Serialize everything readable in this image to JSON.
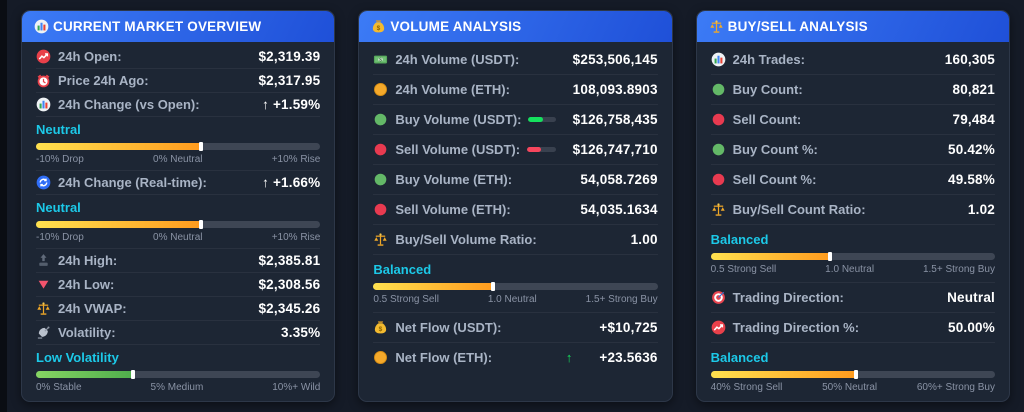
{
  "colors": {
    "green": "#15e15e",
    "red": "#f6465d",
    "cyan": "#1cc9e8",
    "amber_from": "#ffe14f",
    "amber_to": "#ff9b1e",
    "gauge_green_from": "#86d563",
    "gauge_green_to": "#4fae4c",
    "header_blue_from": "#3c7bf6",
    "header_blue_to": "#1f50d8"
  },
  "panels": [
    {
      "id": "current-market-overview",
      "title": "CURRENT MARKET OVERVIEW",
      "header_icon": "bar-chart",
      "items": [
        {
          "type": "row",
          "icon": "chart-up-red",
          "label": "24h Open:",
          "value": "$2,319.39",
          "tone": "white"
        },
        {
          "type": "row",
          "icon": "alarm-clock",
          "label": "Price 24h Ago:",
          "value": "$2,317.95",
          "tone": "white"
        },
        {
          "type": "row",
          "icon": "bar-chart",
          "label": "24h Change (vs Open):",
          "value": "↑ +1.59%",
          "tone": "green"
        },
        {
          "type": "gauge",
          "id": "change-vs-open",
          "status": "Neutral",
          "fill": "amber",
          "fill_pct": 58,
          "ticks": [
            "-10% Drop",
            "0% Neutral",
            "+10% Rise"
          ]
        },
        {
          "type": "row",
          "icon": "refresh-blue",
          "label": "24h Change (Real-time):",
          "value": "↑ +1.66%",
          "tone": "green"
        },
        {
          "type": "gauge",
          "id": "change-realtime",
          "status": "Neutral",
          "fill": "amber",
          "fill_pct": 58,
          "ticks": [
            "-10% Drop",
            "0% Neutral",
            "+10% Rise"
          ]
        },
        {
          "type": "row",
          "icon": "top",
          "label": "24h High:",
          "value": "$2,385.81",
          "tone": "green"
        },
        {
          "type": "row",
          "icon": "triangle-down",
          "label": "24h Low:",
          "value": "$2,308.56",
          "tone": "red"
        },
        {
          "type": "row",
          "icon": "scale-gold",
          "label": "24h VWAP:",
          "value": "$2,345.26",
          "tone": "cyan"
        },
        {
          "type": "row",
          "icon": "satellite",
          "label": "Volatility:",
          "value": "3.35%",
          "tone": "cyan"
        },
        {
          "type": "gauge",
          "id": "volatility",
          "status": "Low Volatility",
          "fill": "green",
          "fill_pct": 34,
          "ticks": [
            "0% Stable",
            "5% Medium",
            "10%+ Wild"
          ]
        }
      ]
    },
    {
      "id": "volume-analysis",
      "title": "VOLUME ANALYSIS",
      "header_icon": "money-bag",
      "items": [
        {
          "type": "row",
          "icon": "banknote-green",
          "label": "24h Volume (USDT):",
          "value": "$253,506,145",
          "tone": "cyan"
        },
        {
          "type": "row",
          "icon": "coin-orange",
          "label": "24h Volume (ETH):",
          "value": "108,093.8903",
          "tone": "white"
        },
        {
          "type": "row",
          "icon": "dot-green",
          "label": "Buy Volume (USDT):",
          "value": "$126,758,435",
          "tone": "white",
          "minibar": {
            "tone": "green",
            "pct": 52
          }
        },
        {
          "type": "row",
          "icon": "dot-red",
          "label": "Sell Volume (USDT):",
          "value": "$126,747,710",
          "tone": "white",
          "minibar": {
            "tone": "red",
            "pct": 50
          }
        },
        {
          "type": "row",
          "icon": "dot-green",
          "label": "Buy Volume (ETH):",
          "value": "54,058.7269",
          "tone": "green"
        },
        {
          "type": "row",
          "icon": "dot-red",
          "label": "Sell Volume (ETH):",
          "value": "54,035.1634",
          "tone": "red"
        },
        {
          "type": "row",
          "icon": "scale-gold",
          "label": "Buy/Sell Volume Ratio:",
          "value": "1.00",
          "tone": "cyan"
        },
        {
          "type": "gauge",
          "id": "volume-ratio",
          "status": "Balanced",
          "fill": "amber",
          "fill_pct": 42,
          "ticks": [
            "0.5 Strong Sell",
            "1.0 Neutral",
            "1.5+ Strong Buy"
          ]
        },
        {
          "type": "row",
          "icon": "money-bag",
          "label": "Net Flow (USDT):",
          "value": "+$10,725",
          "tone": "green"
        },
        {
          "type": "row",
          "icon": "coin-orange",
          "label": "Net Flow (ETH):",
          "arrow": "↑",
          "value": "+23.5636",
          "tone": "green"
        }
      ]
    },
    {
      "id": "buy-sell-analysis",
      "title": "BUY/SELL ANALYSIS",
      "header_icon": "scale-gold",
      "items": [
        {
          "type": "row",
          "icon": "bar-chart",
          "label": "24h Trades:",
          "value": "160,305",
          "tone": "white"
        },
        {
          "type": "row",
          "icon": "dot-green",
          "label": "Buy Count:",
          "value": "80,821",
          "tone": "green"
        },
        {
          "type": "row",
          "icon": "dot-red",
          "label": "Sell Count:",
          "value": "79,484",
          "tone": "red"
        },
        {
          "type": "row",
          "icon": "dot-green",
          "label": "Buy Count %:",
          "value": "50.42%",
          "tone": "green"
        },
        {
          "type": "row",
          "icon": "dot-red",
          "label": "Sell Count %:",
          "value": "49.58%",
          "tone": "red"
        },
        {
          "type": "row",
          "icon": "scale-gold",
          "label": "Buy/Sell Count Ratio:",
          "value": "1.02",
          "tone": "cyan"
        },
        {
          "type": "gauge",
          "id": "count-ratio",
          "status": "Balanced",
          "fill": "amber",
          "fill_pct": 42,
          "ticks": [
            "0.5 Strong Sell",
            "1.0 Neutral",
            "1.5+ Strong Buy"
          ]
        },
        {
          "type": "row",
          "icon": "target",
          "label": "Trading Direction:",
          "value": "Neutral",
          "tone": "white"
        },
        {
          "type": "row",
          "icon": "chart-up-red",
          "label": "Trading Direction %:",
          "value": "50.00%",
          "tone": "white"
        },
        {
          "type": "gauge",
          "id": "direction",
          "status": "Balanced",
          "fill": "amber",
          "fill_pct": 51,
          "ticks": [
            "40% Strong Sell",
            "50% Neutral",
            "60%+ Strong Buy"
          ]
        }
      ]
    }
  ]
}
